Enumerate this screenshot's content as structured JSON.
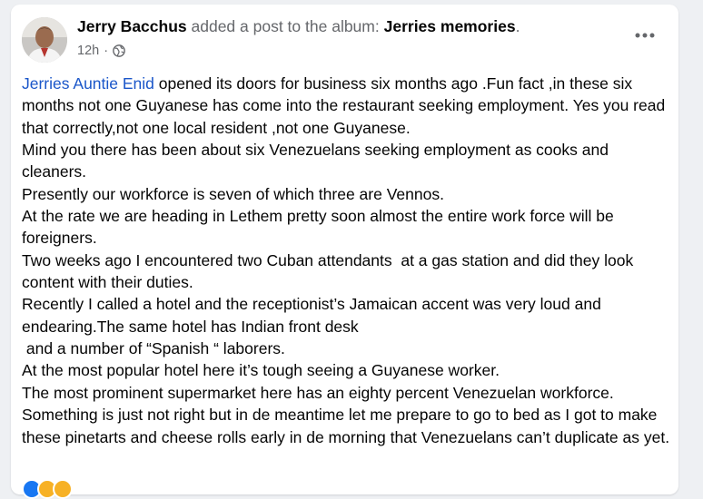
{
  "post": {
    "author": "Jerry Bacchus",
    "action": " added a post to the album: ",
    "album": "Jerries memories",
    "album_suffix": ".",
    "time": "12h",
    "separator": "·",
    "privacy_icon": "globe-icon",
    "more_icon": "more-options-icon",
    "mention": "Jerries Auntie Enid",
    "first_line_rest": " opened its doors for business six months ago .Fun fact ,in these six months not one Guyanese has come into the restaurant seeking employment. Yes you read that correctly,not one local resident ,not one Guyanese.",
    "paragraphs": [
      "Mind you there has been about six Venezuelans seeking employment as cooks and cleaners.",
      "Presently our workforce is seven of which three are Vennos.",
      "At the rate we are heading in Lethem pretty soon almost the entire work force will be foreigners.",
      "Two weeks ago I encountered two Cuban attendants  at a gas station and did they look content with their duties.",
      "Recently I called a hotel and the receptionist’s Jamaican accent was very loud and endearing.The same hotel has Indian front desk",
      " and a number of “Spanish “ laborers.",
      "At the most popular hotel here it’s tough seeing a Guyanese worker.",
      "The most prominent supermarket here has an eighty percent Venezuelan workforce.",
      "Something is just not right but in de meantime let me prepare to go to bed as I got to make these pinetarts and cheese rolls early in de morning that Venezuelans can’t duplicate as yet."
    ]
  },
  "colors": {
    "link": "#1a56c9",
    "text": "#050505",
    "secondary": "#65676b",
    "background": "#eef0f3"
  }
}
